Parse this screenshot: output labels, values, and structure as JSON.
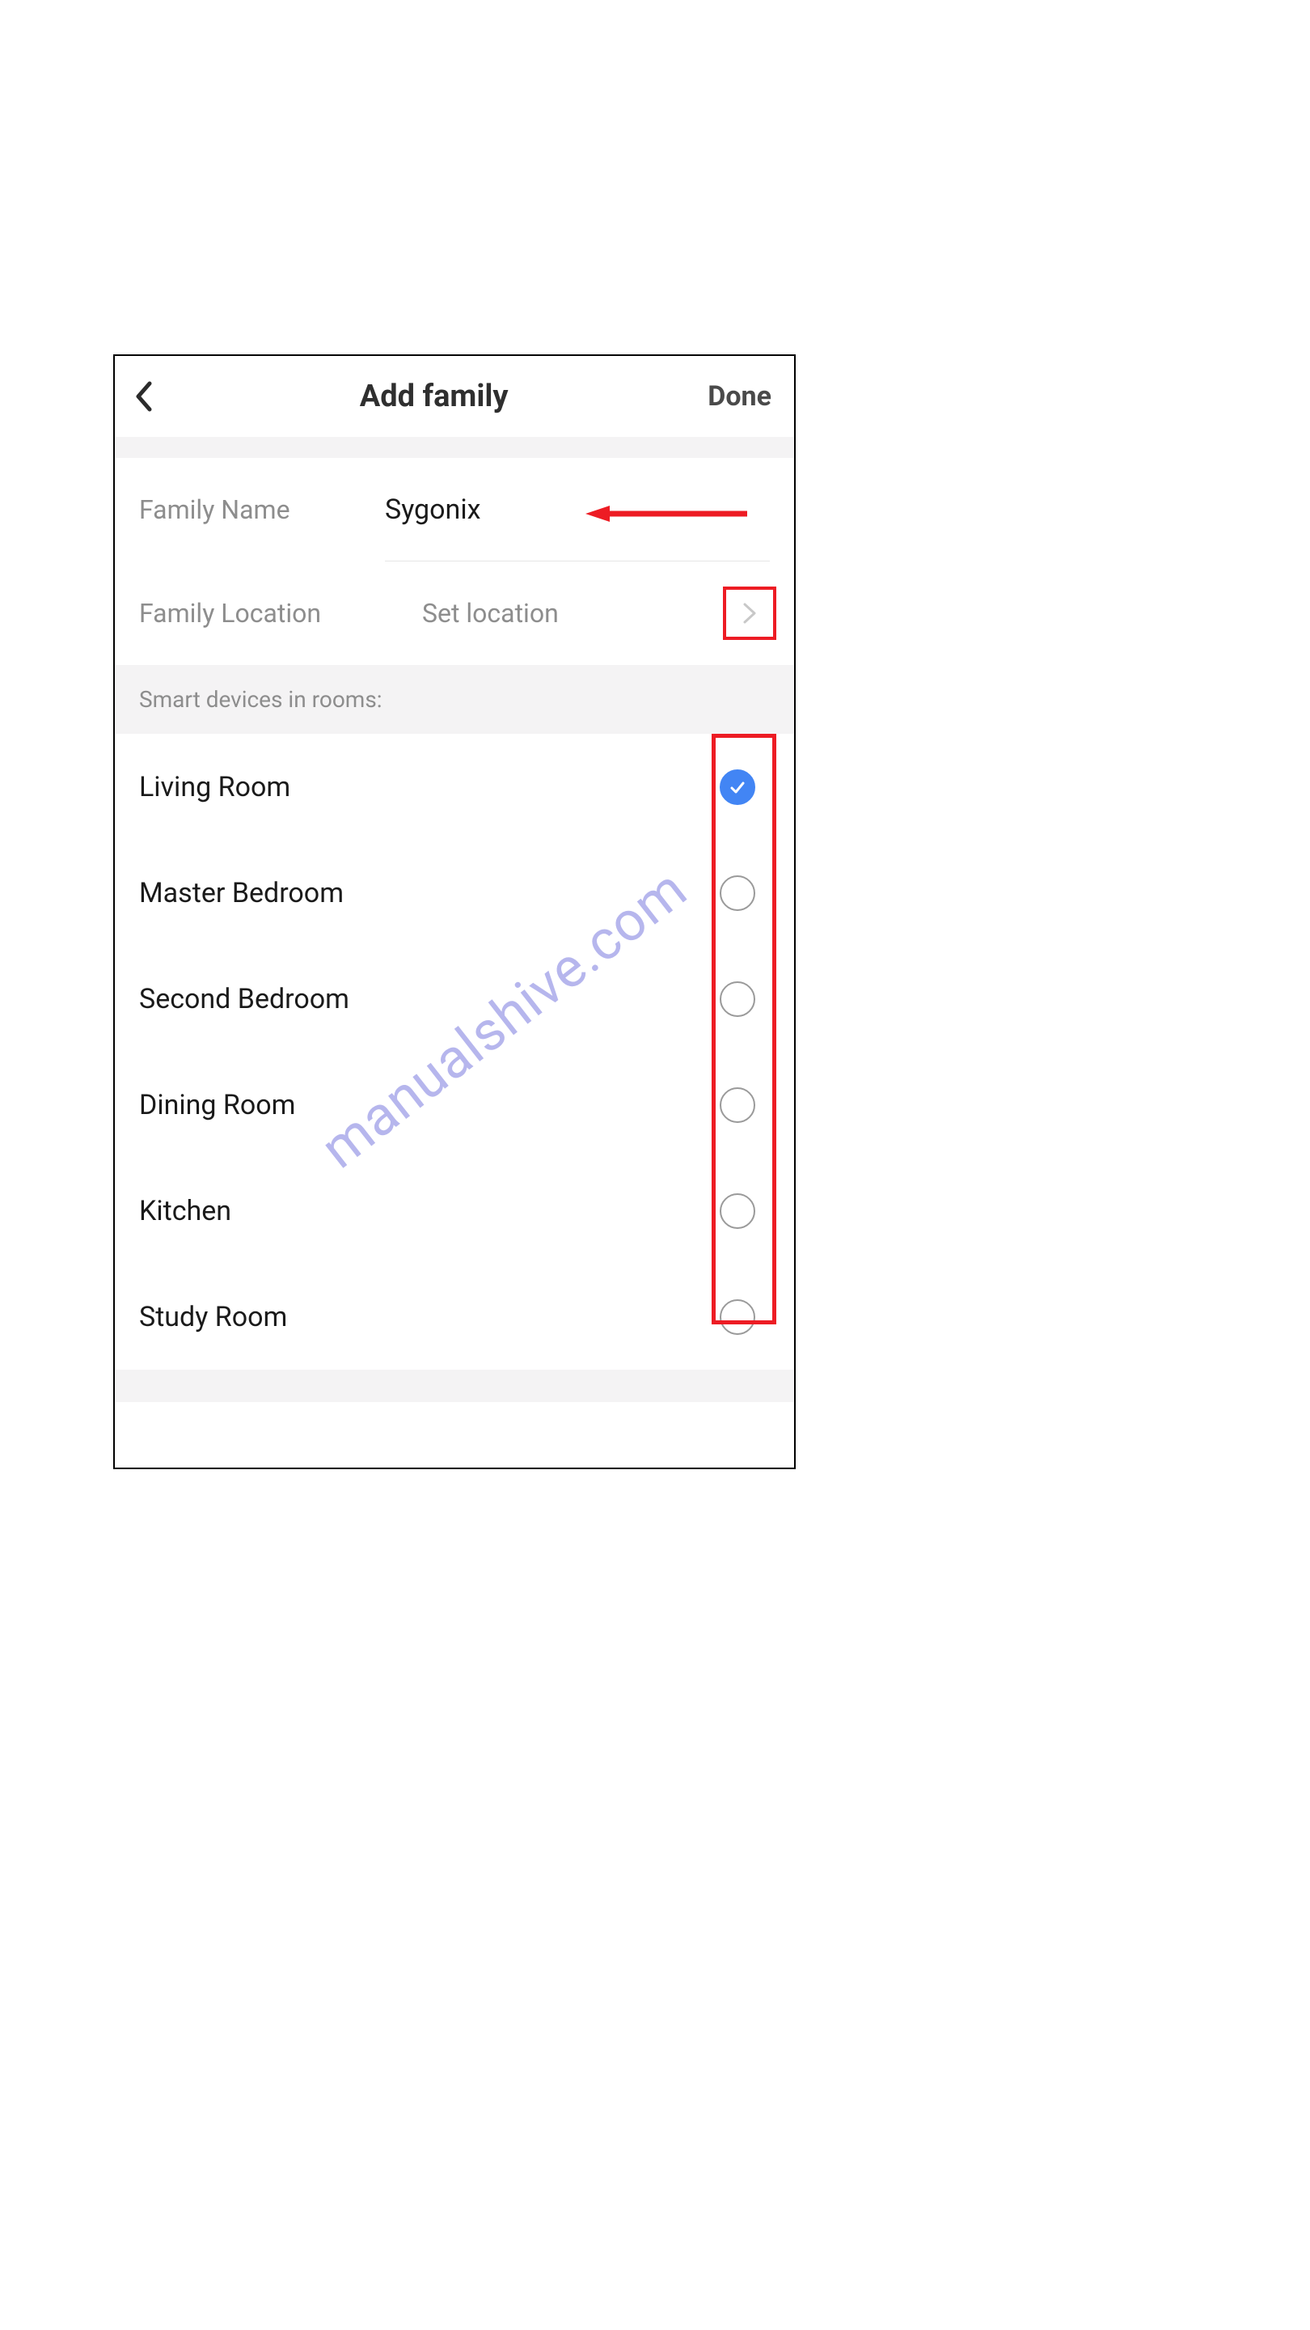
{
  "header": {
    "title": "Add family",
    "done_label": "Done"
  },
  "form": {
    "name_label": "Family Name",
    "name_value": "Sygonix",
    "location_label": "Family Location",
    "location_placeholder": "Set location"
  },
  "section_header": "Smart devices in rooms:",
  "rooms": [
    {
      "name": "Living Room",
      "checked": true
    },
    {
      "name": "Master Bedroom",
      "checked": false
    },
    {
      "name": "Second Bedroom",
      "checked": false
    },
    {
      "name": "Dining Room",
      "checked": false
    },
    {
      "name": "Kitchen",
      "checked": false
    },
    {
      "name": "Study Room",
      "checked": false
    }
  ],
  "watermark_text": "manualshive.com"
}
